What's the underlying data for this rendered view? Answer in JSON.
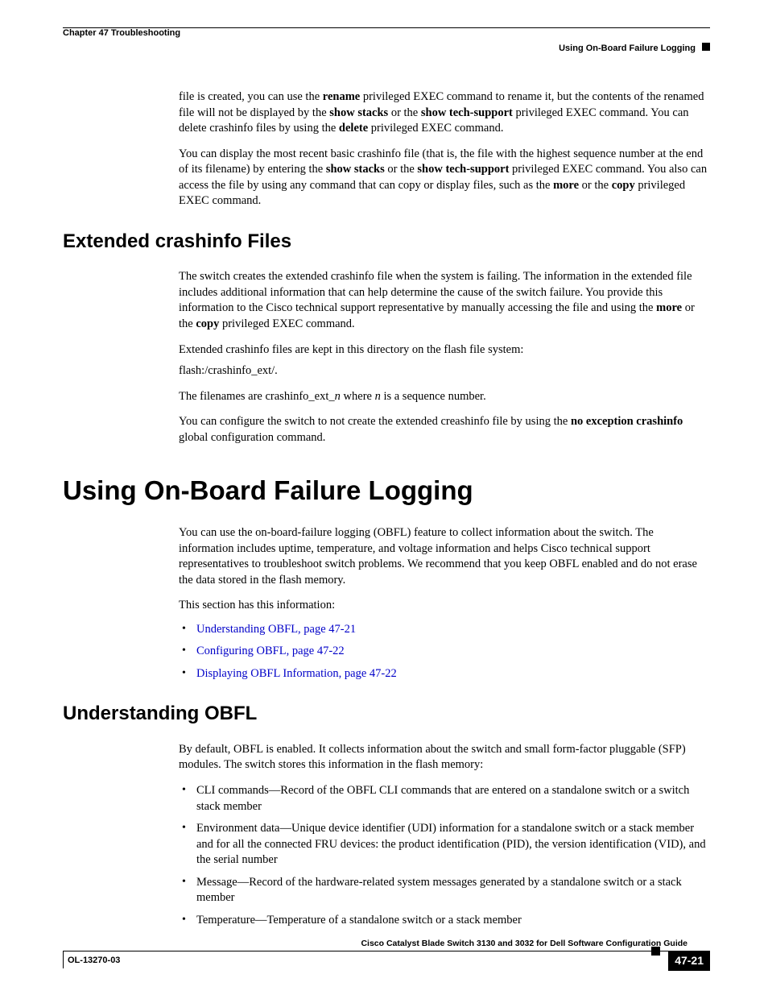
{
  "header": {
    "chapter": "Chapter 47    Troubleshooting",
    "section": "Using On-Board Failure Logging"
  },
  "p1": {
    "t1": "file is created, you can use the ",
    "t2": "rename",
    "t3": " privileged EXEC command to rename it, but the contents of the renamed file will not be displayed by the ",
    "t4": "show stacks",
    "t5": " or the ",
    "t6": "show tech-support",
    "t7": " privileged EXEC command. You can delete crashinfo files by using the ",
    "t8": "delete",
    "t9": " privileged EXEC command."
  },
  "p2": {
    "t1": "You can display the most recent basic crashinfo file (that is, the file with the highest sequence number at the end of its filename) by entering the ",
    "t2": "show stacks",
    "t3": " or the ",
    "t4": "show tech-support",
    "t5": " privileged EXEC command. You also can access the file by using any command that can copy or display files, such as the ",
    "t6": "more",
    "t7": " or the ",
    "t8": "copy",
    "t9": " privileged EXEC command."
  },
  "h2a": "Extended crashinfo Files",
  "p3": {
    "t1": "The switch creates the extended crashinfo file when the system is failing. The information in the extended file includes additional information that can help determine the cause of the switch failure. You provide this information to the Cisco technical support representative by manually accessing the file and using the ",
    "t2": "more",
    "t3": " or the ",
    "t4": "copy",
    "t5": " privileged EXEC command."
  },
  "p4": "Extended crashinfo files are kept in this directory on the flash file system:",
  "p5": "flash:/crashinfo_ext/.",
  "p6": {
    "t1": "The filenames are crashinfo_ext_",
    "t2": "n",
    "t3": " where ",
    "t4": "n",
    "t5": " is a sequence number."
  },
  "p7": {
    "t1": "You can configure the switch to not create the extended creashinfo file by using the ",
    "t2": "no exception crashinfo",
    "t3": " global configuration command."
  },
  "h1a": "Using On-Board Failure Logging",
  "p8": "You can use the on-board-failure logging (OBFL) feature to collect information about the switch. The information includes uptime, temperature, and voltage information and helps Cisco technical support representatives to troubleshoot switch problems. We recommend that you keep OBFL enabled and do not erase the data stored in the flash memory.",
  "p9": "This section has this information:",
  "links": {
    "l1": "Understanding OBFL, page 47-21",
    "l2": "Configuring OBFL, page 47-22",
    "l3": "Displaying OBFL Information, page 47-22"
  },
  "h2b": "Understanding OBFL",
  "p10": "By default, OBFL is enabled. It collects information about the switch and small form-factor pluggable (SFP) modules. The switch stores this information in the flash memory:",
  "items": {
    "i1": "CLI commands—Record of the OBFL CLI commands that are entered on a standalone switch or a switch stack member",
    "i2": "Environment data—Unique device identifier (UDI) information for a standalone switch or a stack member and for all the connected FRU devices: the product identification (PID), the version identification (VID), and the serial number",
    "i3": "Message—Record of the hardware-related system messages generated by a standalone switch or a stack member",
    "i4": "Temperature—Temperature of a standalone switch or a stack member"
  },
  "footer": {
    "title": "Cisco Catalyst Blade Switch 3130 and 3032 for Dell Software Configuration Guide",
    "docid": "OL-13270-03",
    "pagenum": "47-21"
  }
}
